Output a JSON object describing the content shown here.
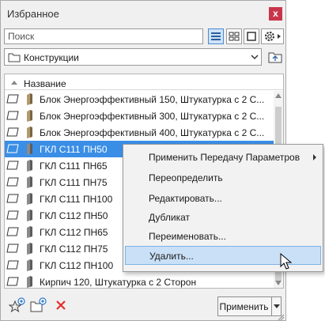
{
  "panel": {
    "title": "Избранное",
    "close_label": "x"
  },
  "search": {
    "placeholder": "Поиск"
  },
  "view_buttons": [
    {
      "icon": "list-view-icon",
      "active": true
    },
    {
      "icon": "grid-view-icon",
      "active": false
    },
    {
      "icon": "single-view-icon",
      "active": false
    }
  ],
  "folder": {
    "label": "Конструкции"
  },
  "list": {
    "header": "Название",
    "rows": [
      {
        "label": "Блок Энергоэффективный 150, Штукатурка с 2 С...",
        "icon": "wall-beige-icon",
        "selected": false
      },
      {
        "label": "Блок Энергоэффективный 300, Штукатурка с 2 С...",
        "icon": "wall-beige-icon",
        "selected": false
      },
      {
        "label": "Блок Энергоэффективный 400, Штукатурка с 2 С...",
        "icon": "wall-beige-icon",
        "selected": false
      },
      {
        "label": "ГКЛ С111 ПН50",
        "icon": "wall-gray-icon",
        "selected": true
      },
      {
        "label": "ГКЛ С111 ПН65",
        "icon": "wall-gray-icon",
        "selected": false
      },
      {
        "label": "ГКЛ С111 ПН75",
        "icon": "wall-gray-icon",
        "selected": false
      },
      {
        "label": "ГКЛ С111 ПН100",
        "icon": "wall-gray-icon",
        "selected": false
      },
      {
        "label": "ГКЛ С112 ПН50",
        "icon": "wall-gray-icon",
        "selected": false
      },
      {
        "label": "ГКЛ С112 ПН65",
        "icon": "wall-gray-icon",
        "selected": false
      },
      {
        "label": "ГКЛ С112 ПН75",
        "icon": "wall-gray-icon",
        "selected": false
      },
      {
        "label": "ГКЛ С112 ПН100",
        "icon": "wall-gray-icon",
        "selected": false
      },
      {
        "label": "Кирпич 120, Штукатурка с 2 Сторон",
        "icon": "wall-gray-icon",
        "selected": false
      }
    ]
  },
  "context_menu": {
    "items": [
      {
        "label": "Применить Передачу Параметров",
        "submenu": true,
        "hover": false
      },
      {
        "label": "Переопределить",
        "submenu": false,
        "hover": false
      },
      {
        "label": "Редактировать...",
        "submenu": false,
        "hover": false
      },
      {
        "label": "Дубликат",
        "submenu": false,
        "hover": false
      },
      {
        "label": "Переименовать...",
        "submenu": false,
        "hover": false
      },
      {
        "label": "Удалить...",
        "submenu": false,
        "hover": true
      }
    ]
  },
  "footer": {
    "apply_label": "Применить",
    "icons": [
      "add-favorite-icon",
      "new-folder-icon",
      "delete-icon"
    ]
  },
  "colors": {
    "selection": "#3a8ee6",
    "menu_hover": "#c9e0f7",
    "close_button": "#c8354b",
    "delete_icon": "#e0302c",
    "accent_blue": "#2a78c8"
  }
}
